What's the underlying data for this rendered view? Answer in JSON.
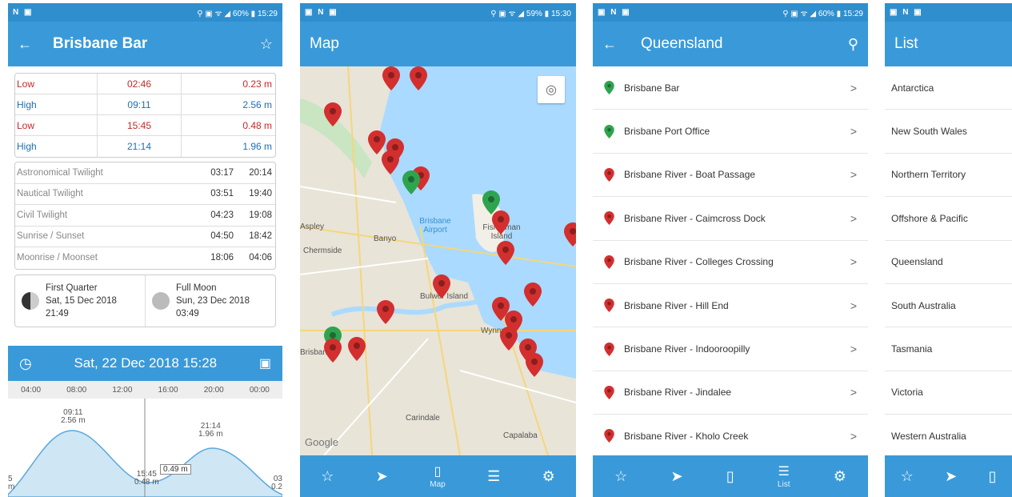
{
  "screens": {
    "detail": {
      "status": {
        "left": "N ▣",
        "right": "⚲ ▣ ᯤ ◢ 60% ▮ 15:29"
      },
      "title": "Brisbane Bar",
      "tides": [
        {
          "type": "Low",
          "time": "02:46",
          "height": "0.23 m"
        },
        {
          "type": "High",
          "time": "09:11",
          "height": "2.56 m"
        },
        {
          "type": "Low",
          "time": "15:45",
          "height": "0.48 m"
        },
        {
          "type": "High",
          "time": "21:14",
          "height": "1.96 m"
        }
      ],
      "sun": [
        {
          "label": "Astronomical Twilight",
          "a": "03:17",
          "b": "20:14"
        },
        {
          "label": "Nautical Twilight",
          "a": "03:51",
          "b": "19:40"
        },
        {
          "label": "Civil Twilight",
          "a": "04:23",
          "b": "19:08"
        },
        {
          "label": "Sunrise / Sunset",
          "a": "04:50",
          "b": "18:42"
        },
        {
          "label": "Moonrise / Moonset",
          "a": "18:06",
          "b": "04:06"
        }
      ],
      "moon": [
        {
          "phase": "First Quarter",
          "date": "Sat, 15 Dec 2018",
          "time": "21:49"
        },
        {
          "phase": "Full Moon",
          "date": "Sun, 23 Dec 2018",
          "time": "03:49"
        }
      ],
      "date": "Sat, 22 Dec 2018 15:28",
      "axis": [
        "04:00",
        "08:00",
        "12:00",
        "16:00",
        "20:00",
        "00:00"
      ],
      "chart_labels": {
        "high1_time": "09:11",
        "high1_h": "2.56 m",
        "high2_time": "21:14",
        "high2_h": "1.96 m",
        "low_time": "15:45",
        "low_h": "0.48 m",
        "now": "0.49 m",
        "left_clip": "5\nm",
        "right_clip": "03\n0.2"
      }
    },
    "map": {
      "status": {
        "left": "▣ N ▣",
        "right": "⚲ ▣ ᯤ ◢ 59% ▮ 15:30"
      },
      "title": "Map",
      "labels": [
        "Aspley",
        "Banyo",
        "Chermside",
        "Brisbane Airport",
        "Fisherman Island",
        "Bulwer Island",
        "Wynnum",
        "Brisbane",
        "Carindale",
        "Capalaba",
        "Google"
      ],
      "nav_label": "Map"
    },
    "region": {
      "status": {
        "left": "▣ N ▣",
        "right": "⚲ ▣ ᯤ ◢ 60% ▮ 15:29"
      },
      "title": "Queensland",
      "items": [
        {
          "name": "Brisbane Bar",
          "color": "#2ea44f"
        },
        {
          "name": "Brisbane Port Office",
          "color": "#2ea44f"
        },
        {
          "name": "Brisbane River - Boat Passage",
          "color": "#d32f2f"
        },
        {
          "name": "Brisbane River - Caimcross Dock",
          "color": "#d32f2f"
        },
        {
          "name": "Brisbane River - Colleges Crossing",
          "color": "#d32f2f"
        },
        {
          "name": "Brisbane River - Hill End",
          "color": "#d32f2f"
        },
        {
          "name": "Brisbane River - Indooroopilly",
          "color": "#d32f2f"
        },
        {
          "name": "Brisbane River - Jindalee",
          "color": "#d32f2f"
        },
        {
          "name": "Brisbane River - Kholo Creek",
          "color": "#d32f2f"
        }
      ],
      "nav_label": "List"
    },
    "list": {
      "status": {
        "left": "▣ N ▣"
      },
      "title": "List",
      "items": [
        "Antarctica",
        "New South Wales",
        "Northern Territory",
        "Offshore & Pacific",
        "Queensland",
        "South Australia",
        "Tasmania",
        "Victoria",
        "Western Australia"
      ]
    }
  },
  "colors": {
    "primary": "#3a9ad9",
    "status": "#2f8fce",
    "low": "#c62828",
    "high": "#1e6fb5",
    "pin_red": "#d32f2f",
    "pin_green": "#2ea44f"
  }
}
